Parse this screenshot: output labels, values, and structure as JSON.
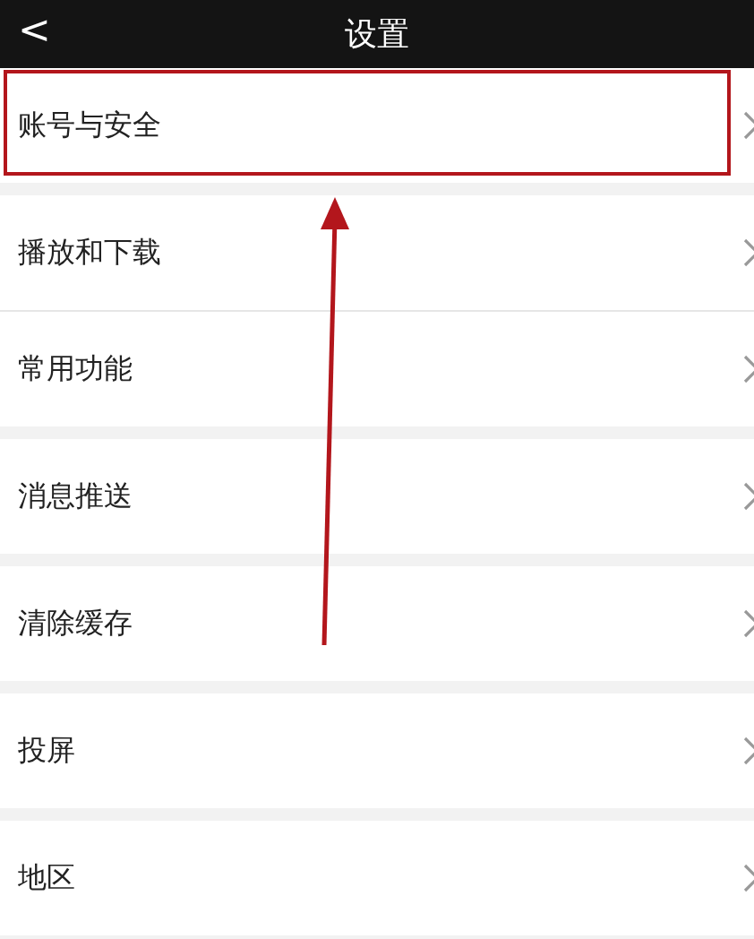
{
  "header": {
    "back": "<",
    "title": "设置"
  },
  "sections": [
    {
      "items": [
        {
          "label": "账号与安全",
          "highlighted": true
        }
      ]
    },
    {
      "items": [
        {
          "label": "播放和下载",
          "highlighted": false
        },
        {
          "label": "常用功能",
          "highlighted": false
        }
      ]
    },
    {
      "items": [
        {
          "label": "消息推送",
          "highlighted": false
        }
      ]
    },
    {
      "items": [
        {
          "label": "清除缓存",
          "highlighted": false
        }
      ]
    },
    {
      "items": [
        {
          "label": "投屏",
          "highlighted": false
        }
      ]
    },
    {
      "items": [
        {
          "label": "地区",
          "highlighted": false
        }
      ]
    }
  ]
}
